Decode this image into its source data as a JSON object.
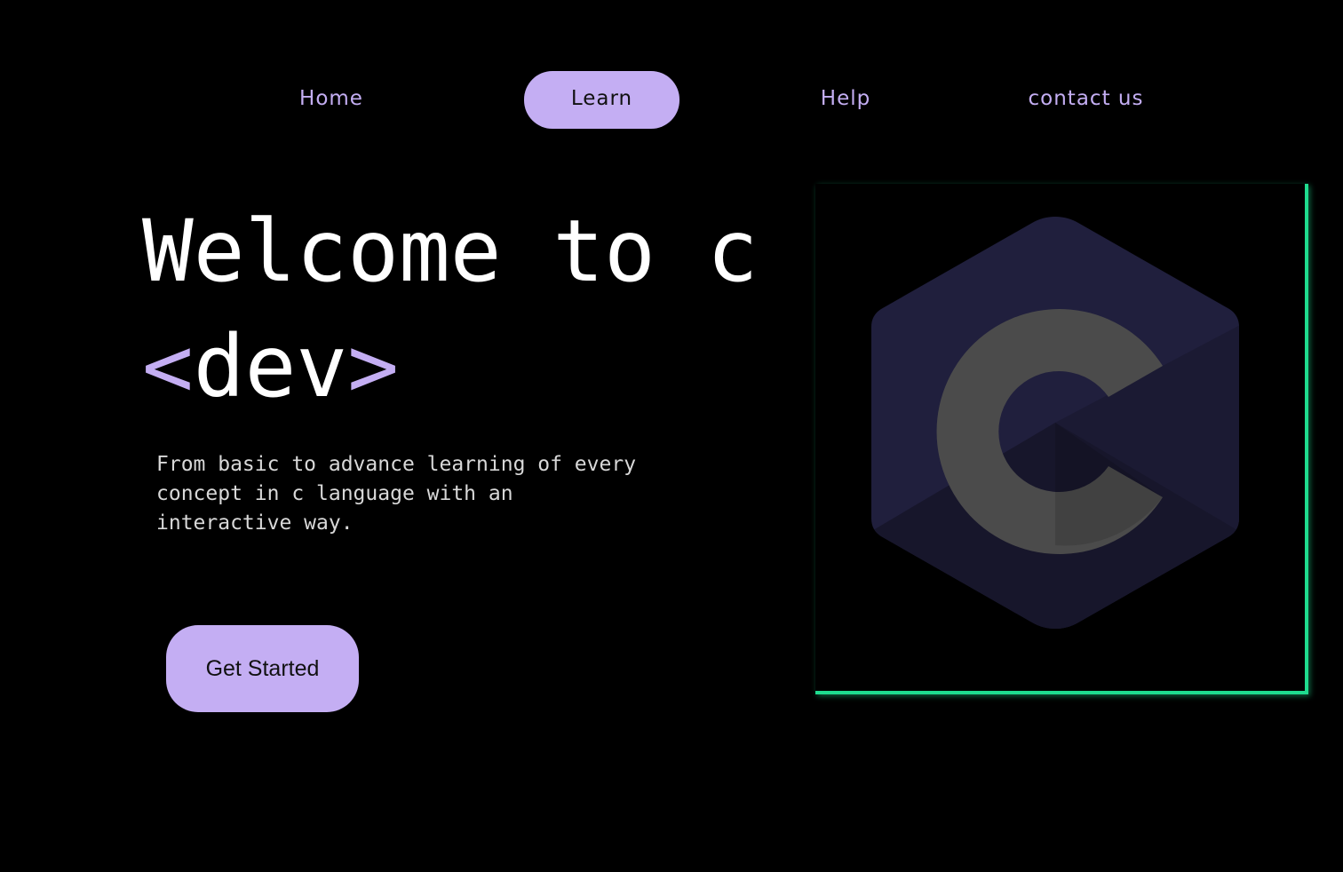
{
  "nav": {
    "items": [
      {
        "label": "Home"
      },
      {
        "label": "Learn",
        "active": true
      },
      {
        "label": "Help"
      },
      {
        "label": "contact us"
      }
    ]
  },
  "hero": {
    "title_line1": "Welcome to c",
    "title_open_bracket": "<",
    "title_word": "dev",
    "title_close_bracket": ">",
    "description": "From basic to advance learning of every concept in c language with an interactive way.",
    "cta_label": "Get Started"
  },
  "logo": {
    "icon": "c-language-logo-icon",
    "letter": "C"
  },
  "colors": {
    "background": "#000000",
    "accent": "#c4aef3",
    "frame": "#1fdc8f",
    "hex_fill": "#1f1e3a",
    "letter_fill": "#4a4a4a"
  }
}
